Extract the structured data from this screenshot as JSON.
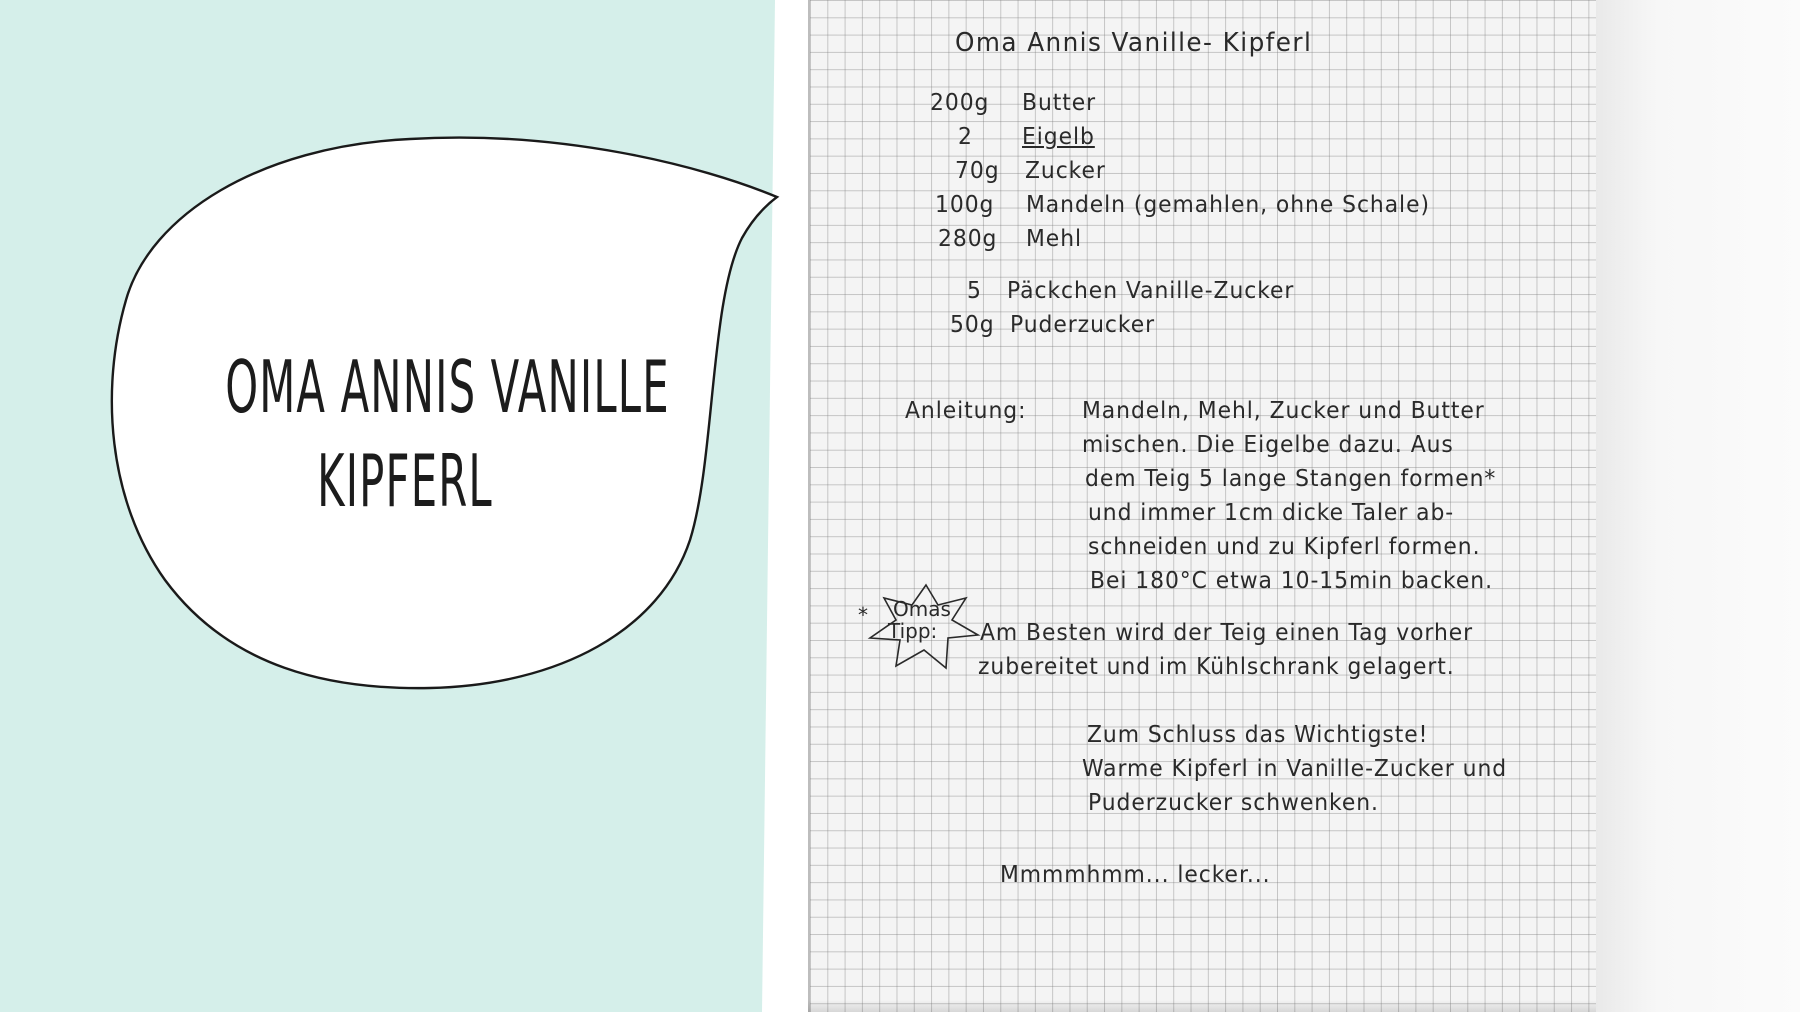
{
  "bubble": {
    "title_line1": "OMA ANNIS VANILLE",
    "title_line2": "KIPFERL"
  },
  "recipe": {
    "title": "Oma Annis Vanille- Kipferl",
    "ingredients": [
      {
        "amount": "200g",
        "item": "Butter"
      },
      {
        "amount": "2",
        "item": "Eigelb"
      },
      {
        "amount": "70g",
        "item": "Zucker"
      },
      {
        "amount": "100g",
        "item": "Mandeln (gemahlen, ohne Schale)"
      },
      {
        "amount": "280g",
        "item": "Mehl"
      },
      {
        "amount": "5",
        "item": "Päckchen Vanille-Zucker"
      },
      {
        "amount": "50g",
        "item": "Puderzucker"
      }
    ],
    "instructions_label": "Anleitung:",
    "instructions_lines": [
      "Mandeln, Mehl, Zucker und Butter",
      "mischen. Die Eigelbe dazu. Aus",
      "dem Teig 5 lange Stangen formen*",
      "und immer 1cm dicke Taler ab-",
      "schneiden und zu Kipferl formen.",
      "Bei 180°C etwa 10-15min backen."
    ],
    "tip_star_asterisk": "*",
    "tip_star_line1": "Omas",
    "tip_star_line2": "Tipp:",
    "tip_lines": [
      "Am Besten wird der Teig einen Tag vorher",
      "zubereitet und im Kühlschrank gelagert."
    ],
    "final_lines": [
      "Zum Schluss das Wichtigste!",
      "Warme Kipferl in Vanille-Zucker und",
      "Puderzucker schwenken."
    ],
    "closing": "Mmmmhmm... lecker..."
  },
  "colors": {
    "panel_background": "#d5efea",
    "paper": "#f4f4f4",
    "ink": "#2a2a2a"
  }
}
